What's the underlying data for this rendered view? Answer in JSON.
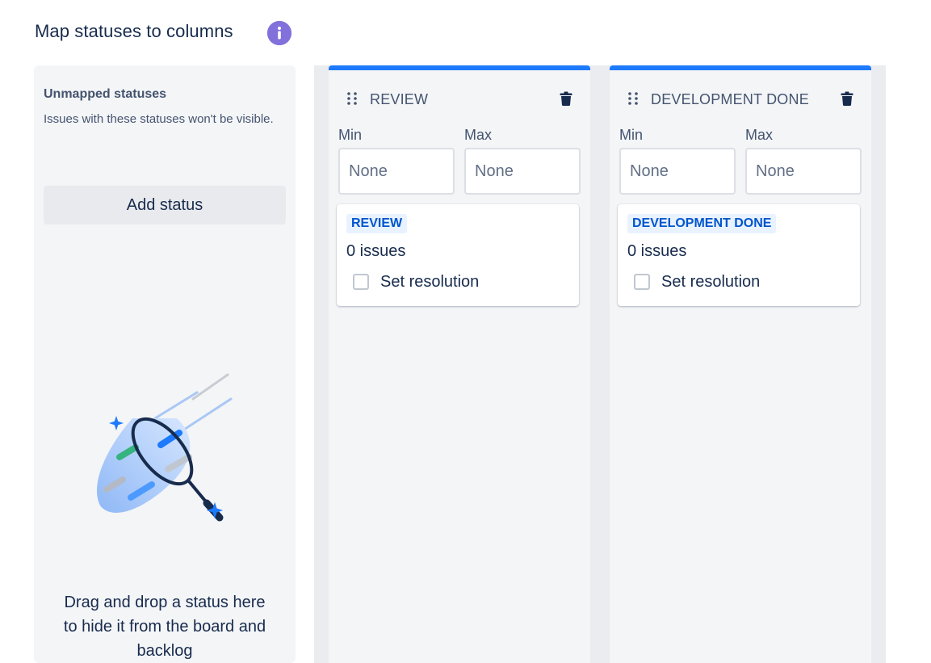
{
  "page": {
    "title": "Map statuses to columns",
    "info_icon": "info-icon",
    "info_color": "#8270db"
  },
  "unmapped": {
    "title": "Unmapped statuses",
    "description": "Issues with these statuses won't be visible.",
    "add_status_label": "Add status",
    "drop_hint": "Drag and drop a status here to hide it from the board and backlog"
  },
  "columns": [
    {
      "name": "REVIEW",
      "min_label": "Min",
      "max_label": "Max",
      "min_placeholder": "None",
      "max_placeholder": "None",
      "status": {
        "lozenge": "REVIEW",
        "issue_count": "0 issues",
        "resolution_label": "Set resolution",
        "resolution_checked": false
      }
    },
    {
      "name": "DEVELOPMENT DONE",
      "min_label": "Min",
      "max_label": "Max",
      "min_placeholder": "None",
      "max_placeholder": "None",
      "status": {
        "lozenge": "DEVELOPMENT DONE",
        "issue_count": "0 issues",
        "resolution_label": "Set resolution",
        "resolution_checked": false
      }
    }
  ],
  "colors": {
    "column_accent": "#1d7afc",
    "lozenge_bg": "#e9f2ff",
    "lozenge_text": "#0055cc"
  }
}
